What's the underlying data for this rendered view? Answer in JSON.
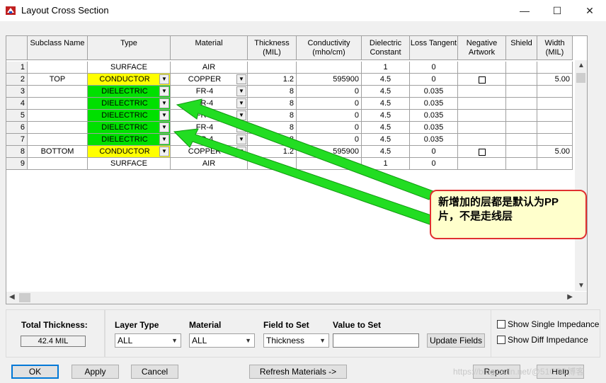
{
  "window": {
    "title": "Layout Cross Section",
    "minimize": "—",
    "maximize": "☐",
    "close": "✕"
  },
  "grid": {
    "headers": {
      "subclass": "Subclass Name",
      "type": "Type",
      "material": "Material",
      "thickness": "Thickness (MIL)",
      "conductivity": "Conductivity (mho/cm)",
      "dielectric": "Dielectric Constant",
      "loss": "Loss Tangent",
      "negative": "Negative Artwork",
      "shield": "Shield",
      "width": "Width (MIL)"
    },
    "rows": [
      {
        "num": "1",
        "subclass": "",
        "type": "SURFACE",
        "type_color": "",
        "type_dd": false,
        "material": "AIR",
        "material_dd": false,
        "thickness": "",
        "conductivity": "",
        "dielectric": "1",
        "loss": "0",
        "negative": false,
        "width": ""
      },
      {
        "num": "2",
        "subclass": "TOP",
        "type": "CONDUCTOR",
        "type_color": "yellow",
        "type_dd": true,
        "material": "COPPER",
        "material_dd": true,
        "thickness": "1.2",
        "conductivity": "595900",
        "dielectric": "4.5",
        "loss": "0",
        "negative": true,
        "width": "5.00"
      },
      {
        "num": "3",
        "subclass": "",
        "type": "DIELECTRIC",
        "type_color": "green",
        "type_dd": true,
        "material": "FR-4",
        "material_dd": true,
        "thickness": "8",
        "conductivity": "0",
        "dielectric": "4.5",
        "loss": "0.035",
        "negative": false,
        "width": ""
      },
      {
        "num": "4",
        "subclass": "",
        "type": "DIELECTRIC",
        "type_color": "green",
        "type_dd": true,
        "material": "FR-4",
        "material_dd": true,
        "thickness": "8",
        "conductivity": "0",
        "dielectric": "4.5",
        "loss": "0.035",
        "negative": false,
        "width": ""
      },
      {
        "num": "5",
        "subclass": "",
        "type": "DIELECTRIC",
        "type_color": "green",
        "type_dd": true,
        "material": "FR-4",
        "material_dd": true,
        "thickness": "8",
        "conductivity": "0",
        "dielectric": "4.5",
        "loss": "0.035",
        "negative": false,
        "width": ""
      },
      {
        "num": "6",
        "subclass": "",
        "type": "DIELECTRIC",
        "type_color": "green",
        "type_dd": true,
        "material": "FR-4",
        "material_dd": true,
        "thickness": "8",
        "conductivity": "0",
        "dielectric": "4.5",
        "loss": "0.035",
        "negative": false,
        "width": ""
      },
      {
        "num": "7",
        "subclass": "",
        "type": "DIELECTRIC",
        "type_color": "green",
        "type_dd": true,
        "material": "FR-4",
        "material_dd": true,
        "thickness": "8",
        "conductivity": "0",
        "dielectric": "4.5",
        "loss": "0.035",
        "negative": false,
        "width": ""
      },
      {
        "num": "8",
        "subclass": "BOTTOM",
        "type": "CONDUCTOR",
        "type_color": "yellow",
        "type_dd": true,
        "material": "COPPER",
        "material_dd": true,
        "thickness": "1.2",
        "conductivity": "595900",
        "dielectric": "4.5",
        "loss": "0",
        "negative": true,
        "width": "5.00"
      },
      {
        "num": "9",
        "subclass": "",
        "type": "SURFACE",
        "type_color": "",
        "type_dd": false,
        "material": "AIR",
        "material_dd": false,
        "thickness": "",
        "conductivity": "",
        "dielectric": "1",
        "loss": "0",
        "negative": false,
        "width": ""
      }
    ]
  },
  "bottom": {
    "total_thickness_label": "Total Thickness:",
    "total_thickness_value": "42.4 MIL",
    "layer_type_label": "Layer Type",
    "layer_type_value": "ALL",
    "material_label": "Material",
    "material_value": "ALL",
    "field_label": "Field to Set",
    "field_value": "Thickness",
    "value_label": "Value to Set",
    "value_value": "",
    "update_fields": "Update Fields",
    "show_single": "Show Single Impedance",
    "show_diff": "Show Diff Impedance"
  },
  "buttons": {
    "ok": "OK",
    "apply": "Apply",
    "cancel": "Cancel",
    "refresh": "Refresh Materials ->",
    "report": "Report",
    "help": "Help"
  },
  "annotation": {
    "text": "新增加的层都是默认为PP片，不是走线层"
  },
  "watermark": "https://blog.csdn.net/@51CTO博客",
  "colors": {
    "conductor": "#ffff00",
    "dielectric": "#00e000",
    "arrow": "#22dd22",
    "callout_border": "#e03030",
    "callout_fill": "#ffffcc"
  }
}
